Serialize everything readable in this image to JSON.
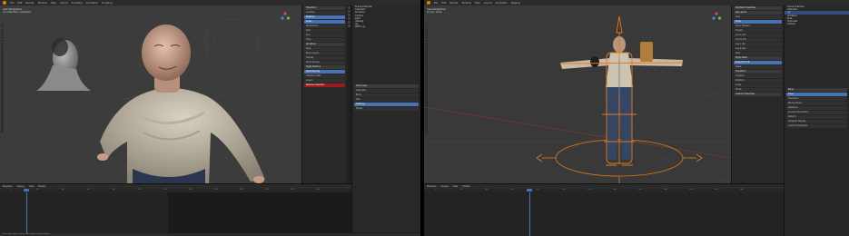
{
  "left_window": {
    "menu": [
      "Blender",
      "File",
      "Edit",
      "Render",
      "Window",
      "Help",
      "Layout",
      "Sculpting",
      "Animation",
      "Scripting"
    ],
    "viewport_info": [
      "User Perspective",
      "(1) Collection | Armature"
    ],
    "panel_rows": [
      "Transform",
      "Location",
      "Rotation",
      "Scale",
      "Dimensions",
      "Item",
      "Tool",
      "View",
      "Armature",
      "Pose",
      "Bone Layers",
      "Display",
      "Bone Groups",
      "Rigify Buttons",
      "Generate Rig",
      "Selection Sets",
      "Layers",
      "Remove Selected"
    ],
    "outliner_items": [
      "Scene Collection",
      "Collection",
      "Armature",
      "Camera",
      "Light",
      "metarig",
      "rig",
      "WGTS_rig"
    ],
    "outliner_panel_rows": [
      "View Layer",
      "Character",
      "Body",
      "Hair",
      "Clothing",
      "Shoes"
    ],
    "timeline": {
      "menu": [
        "Playback",
        "Keying",
        "View",
        "Marker"
      ],
      "ticks": [
        "0",
        "20",
        "40",
        "60",
        "80",
        "100",
        "120",
        "140",
        "160",
        "180",
        "200",
        "220",
        "240"
      ],
      "current_frame": "0"
    },
    "status": "Select   Box Select   Rotate View   Object Context Menu"
  },
  "right_window": {
    "menu": [
      "Blender",
      "File",
      "Edit",
      "Render",
      "Window",
      "Help",
      "Layout",
      "Animation",
      "Rigging"
    ],
    "viewport_info": [
      "User Perspective",
      "(1) rig : torso"
    ],
    "panel_rows": [
      "Rig Main Properties",
      "Rig Layers",
      "Face",
      "Torso",
      "Torso (Tweak)",
      "Fingers",
      "Arm.L (IK)",
      "Arm.R (IK)",
      "Leg.L (IK)",
      "Leg.R (IK)",
      "Root",
      "Rigify Bake",
      "Snap IK to FK",
      "Reset",
      "Transform",
      "Location",
      "Rotation",
      "Scale",
      "Mode",
      "Custom Properties"
    ],
    "outliner_items": [
      "Scene Collection",
      "Collection",
      "rig",
      "Armature",
      "Pose",
      "Character",
      "Camera"
    ],
    "props_rows": [
      "Bone",
      "torso",
      "Transform",
      "Bendy Bones",
      "Relations",
      "Inverse Kinematics",
      "Deform",
      "Viewport Display",
      "Custom Properties"
    ],
    "timeline": {
      "menu": [
        "Playback",
        "Keying",
        "View",
        "Marker"
      ],
      "ticks": [
        "0",
        "20",
        "40",
        "60",
        "80",
        "100",
        "120",
        "140",
        "160",
        "180",
        "200",
        "220",
        "240"
      ],
      "current_frame": "41"
    }
  },
  "colors": {
    "accent": "#4772b3",
    "warning": "#9b1c1c",
    "bone": "#e07b1a",
    "background": "#3c3c3c"
  },
  "icons": [
    "blender-logo-icon",
    "navigation-gizmo-icon",
    "tool-icon"
  ]
}
